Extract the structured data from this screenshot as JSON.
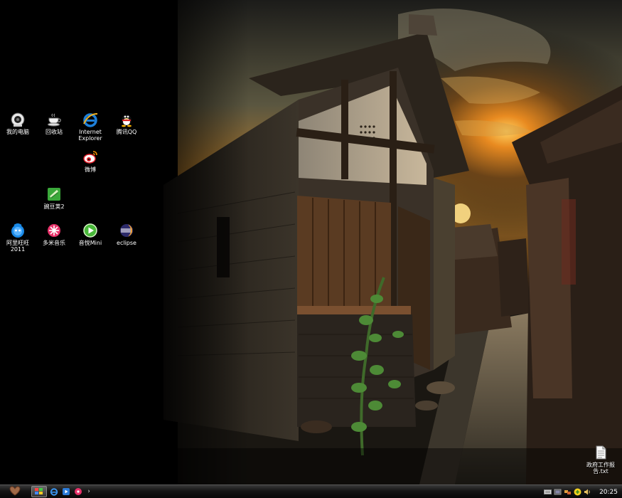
{
  "desktop": {
    "icons": [
      {
        "id": "my-computer",
        "label": "我的电脑",
        "icon": "my-computer-icon"
      },
      {
        "id": "recycle-bin",
        "label": "回收站",
        "icon": "recycle-bin-icon"
      },
      {
        "id": "internet-explorer",
        "label": "Internet\nExplorer",
        "icon": "internet-explorer-icon"
      },
      {
        "id": "tencent-qq",
        "label": "腾讯QQ",
        "icon": "qq-penguin-icon"
      },
      {
        "id": "weibo",
        "label": "微博",
        "icon": "weibo-icon"
      },
      {
        "id": "wandoujia",
        "label": "豌豆荚2",
        "icon": "wandoujia-icon"
      },
      {
        "id": "aliwangwang",
        "label": "阿里旺旺\n2011",
        "icon": "aliwangwang-icon"
      },
      {
        "id": "duomi-music",
        "label": "多米音乐",
        "icon": "duomi-music-icon"
      },
      {
        "id": "yinyue-mini",
        "label": "音悦Mini",
        "icon": "yinyue-play-icon"
      },
      {
        "id": "eclipse",
        "label": "eclipse",
        "icon": "eclipse-icon"
      },
      {
        "id": "report-file",
        "label": "政府工作报\n告.txt",
        "icon": "text-file-icon"
      }
    ]
  },
  "taskbar": {
    "start_icon": "heart-start-icon",
    "quick_launch": [
      "show-desktop-icon",
      "internet-explorer-icon",
      "media-player-icon",
      "duomi-music-icon"
    ],
    "more_label": "›",
    "tray_icons": [
      "keyboard-icon",
      "tray-app-icon",
      "network-icon",
      "qq-tray-icon",
      "volume-icon"
    ],
    "clock": "20:25"
  }
}
